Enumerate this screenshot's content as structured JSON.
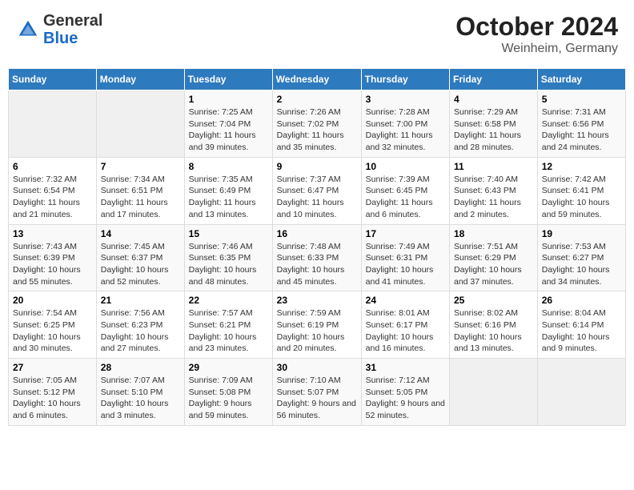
{
  "header": {
    "logo_general": "General",
    "logo_blue": "Blue",
    "month": "October 2024",
    "location": "Weinheim, Germany"
  },
  "weekdays": [
    "Sunday",
    "Monday",
    "Tuesday",
    "Wednesday",
    "Thursday",
    "Friday",
    "Saturday"
  ],
  "weeks": [
    [
      {
        "day": "",
        "empty": true
      },
      {
        "day": "",
        "empty": true
      },
      {
        "day": "1",
        "sunrise": "7:25 AM",
        "sunset": "7:04 PM",
        "daylight": "11 hours and 39 minutes."
      },
      {
        "day": "2",
        "sunrise": "7:26 AM",
        "sunset": "7:02 PM",
        "daylight": "11 hours and 35 minutes."
      },
      {
        "day": "3",
        "sunrise": "7:28 AM",
        "sunset": "7:00 PM",
        "daylight": "11 hours and 32 minutes."
      },
      {
        "day": "4",
        "sunrise": "7:29 AM",
        "sunset": "6:58 PM",
        "daylight": "11 hours and 28 minutes."
      },
      {
        "day": "5",
        "sunrise": "7:31 AM",
        "sunset": "6:56 PM",
        "daylight": "11 hours and 24 minutes."
      }
    ],
    [
      {
        "day": "6",
        "sunrise": "7:32 AM",
        "sunset": "6:54 PM",
        "daylight": "11 hours and 21 minutes."
      },
      {
        "day": "7",
        "sunrise": "7:34 AM",
        "sunset": "6:51 PM",
        "daylight": "11 hours and 17 minutes."
      },
      {
        "day": "8",
        "sunrise": "7:35 AM",
        "sunset": "6:49 PM",
        "daylight": "11 hours and 13 minutes."
      },
      {
        "day": "9",
        "sunrise": "7:37 AM",
        "sunset": "6:47 PM",
        "daylight": "11 hours and 10 minutes."
      },
      {
        "day": "10",
        "sunrise": "7:39 AM",
        "sunset": "6:45 PM",
        "daylight": "11 hours and 6 minutes."
      },
      {
        "day": "11",
        "sunrise": "7:40 AM",
        "sunset": "6:43 PM",
        "daylight": "11 hours and 2 minutes."
      },
      {
        "day": "12",
        "sunrise": "7:42 AM",
        "sunset": "6:41 PM",
        "daylight": "10 hours and 59 minutes."
      }
    ],
    [
      {
        "day": "13",
        "sunrise": "7:43 AM",
        "sunset": "6:39 PM",
        "daylight": "10 hours and 55 minutes."
      },
      {
        "day": "14",
        "sunrise": "7:45 AM",
        "sunset": "6:37 PM",
        "daylight": "10 hours and 52 minutes."
      },
      {
        "day": "15",
        "sunrise": "7:46 AM",
        "sunset": "6:35 PM",
        "daylight": "10 hours and 48 minutes."
      },
      {
        "day": "16",
        "sunrise": "7:48 AM",
        "sunset": "6:33 PM",
        "daylight": "10 hours and 45 minutes."
      },
      {
        "day": "17",
        "sunrise": "7:49 AM",
        "sunset": "6:31 PM",
        "daylight": "10 hours and 41 minutes."
      },
      {
        "day": "18",
        "sunrise": "7:51 AM",
        "sunset": "6:29 PM",
        "daylight": "10 hours and 37 minutes."
      },
      {
        "day": "19",
        "sunrise": "7:53 AM",
        "sunset": "6:27 PM",
        "daylight": "10 hours and 34 minutes."
      }
    ],
    [
      {
        "day": "20",
        "sunrise": "7:54 AM",
        "sunset": "6:25 PM",
        "daylight": "10 hours and 30 minutes."
      },
      {
        "day": "21",
        "sunrise": "7:56 AM",
        "sunset": "6:23 PM",
        "daylight": "10 hours and 27 minutes."
      },
      {
        "day": "22",
        "sunrise": "7:57 AM",
        "sunset": "6:21 PM",
        "daylight": "10 hours and 23 minutes."
      },
      {
        "day": "23",
        "sunrise": "7:59 AM",
        "sunset": "6:19 PM",
        "daylight": "10 hours and 20 minutes."
      },
      {
        "day": "24",
        "sunrise": "8:01 AM",
        "sunset": "6:17 PM",
        "daylight": "10 hours and 16 minutes."
      },
      {
        "day": "25",
        "sunrise": "8:02 AM",
        "sunset": "6:16 PM",
        "daylight": "10 hours and 13 minutes."
      },
      {
        "day": "26",
        "sunrise": "8:04 AM",
        "sunset": "6:14 PM",
        "daylight": "10 hours and 9 minutes."
      }
    ],
    [
      {
        "day": "27",
        "sunrise": "7:05 AM",
        "sunset": "5:12 PM",
        "daylight": "10 hours and 6 minutes."
      },
      {
        "day": "28",
        "sunrise": "7:07 AM",
        "sunset": "5:10 PM",
        "daylight": "10 hours and 3 minutes."
      },
      {
        "day": "29",
        "sunrise": "7:09 AM",
        "sunset": "5:08 PM",
        "daylight": "9 hours and 59 minutes."
      },
      {
        "day": "30",
        "sunrise": "7:10 AM",
        "sunset": "5:07 PM",
        "daylight": "9 hours and 56 minutes."
      },
      {
        "day": "31",
        "sunrise": "7:12 AM",
        "sunset": "5:05 PM",
        "daylight": "9 hours and 52 minutes."
      },
      {
        "day": "",
        "empty": true
      },
      {
        "day": "",
        "empty": true
      }
    ]
  ]
}
